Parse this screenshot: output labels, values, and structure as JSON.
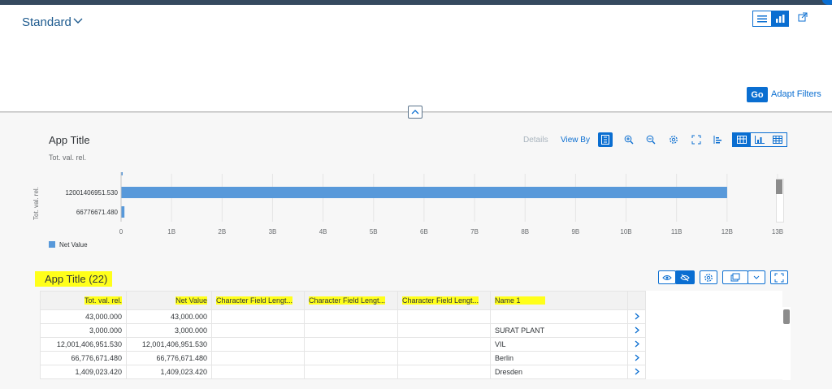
{
  "header": {
    "variant_label": "Standard",
    "go_label": "Go",
    "adapt_filters_label": "Adapt Filters"
  },
  "chart_panel": {
    "title": "App Title",
    "subtitle": "Tot. val. rel.",
    "details_label": "Details",
    "view_by_label": "View By",
    "legend_label": "Net Value",
    "y_axis_title": "Tot. val. rel."
  },
  "chart_data": {
    "type": "bar",
    "orientation": "horizontal",
    "categories": [
      "",
      "12001406951.530",
      "66776671.480"
    ],
    "series": [
      {
        "name": "Net Value",
        "values": [
          43000,
          12001406951.53,
          66776671.48
        ]
      }
    ],
    "xlim": [
      0,
      13000000000
    ],
    "x_ticks": [
      "0",
      "1B",
      "2B",
      "3B",
      "4B",
      "5B",
      "6B",
      "7B",
      "8B",
      "9B",
      "10B",
      "11B",
      "12B",
      "13B"
    ],
    "tick_values": [
      0,
      1000000000,
      2000000000,
      3000000000,
      4000000000,
      5000000000,
      6000000000,
      7000000000,
      8000000000,
      9000000000,
      10000000000,
      11000000000,
      12000000000,
      13000000000
    ],
    "ylabel": "Tot. val. rel.",
    "grid": true,
    "legend": "bottom-left",
    "color": "#5899da"
  },
  "table": {
    "title": "App Title (22)",
    "columns": [
      "Tot. val. rel.",
      "Net Value",
      "Character Field Lengt...",
      "Character Field Lengt...",
      "Character Field Lengt...",
      "Name 1"
    ],
    "rows": [
      [
        "43,000.000",
        "43,000.000",
        "",
        "",
        "",
        ""
      ],
      [
        "3,000.000",
        "3,000.000",
        "",
        "",
        "",
        "SURAT PLANT"
      ],
      [
        "12,001,406,951.530",
        "12,001,406,951.530",
        "",
        "",
        "",
        "VIL"
      ],
      [
        "66,776,671.480",
        "66,776,671.480",
        "",
        "",
        "",
        "Berlin"
      ],
      [
        "1,409,023.420",
        "1,409,023.420",
        "",
        "",
        "",
        "Dresden"
      ]
    ]
  },
  "colors": {
    "accent": "#0a6ed1",
    "bar": "#5899da",
    "highlight": "#ffff1a",
    "shell": "#354a5f"
  }
}
